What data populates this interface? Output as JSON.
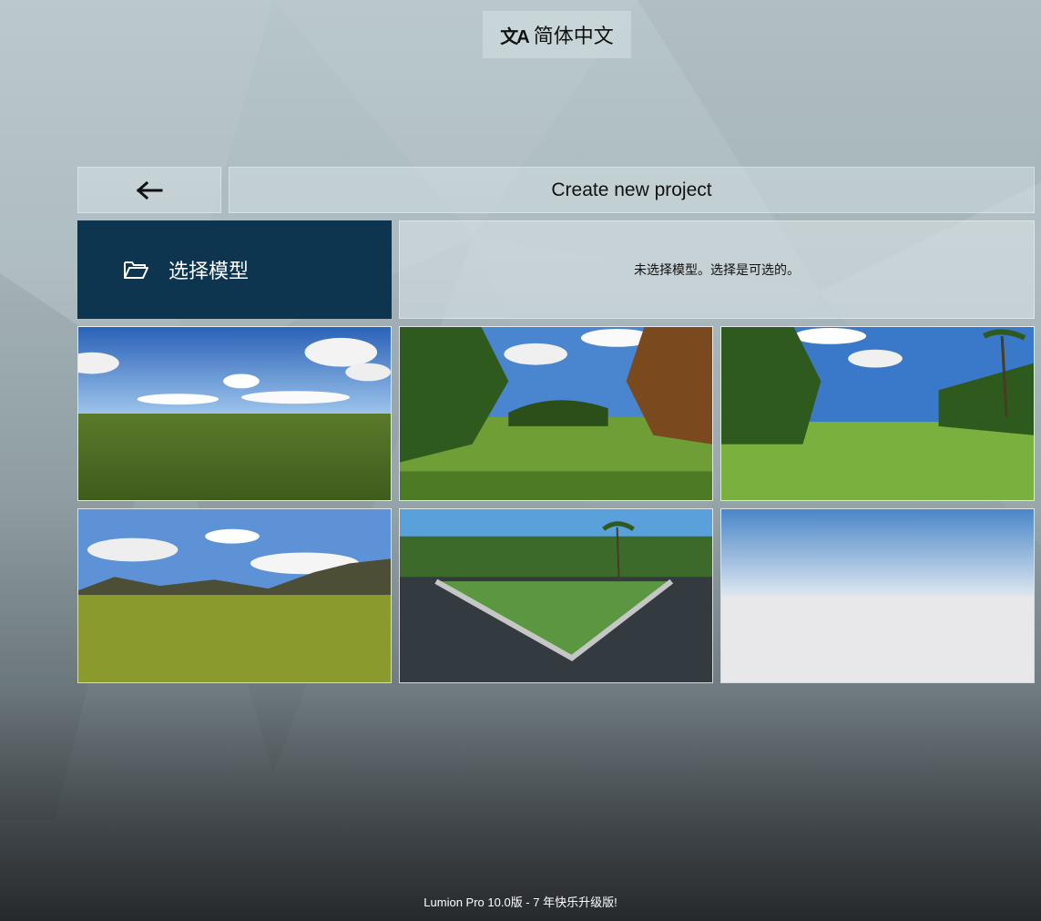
{
  "language": {
    "icon": "translate-icon",
    "icon_glyph": "文A",
    "label": "简体中文"
  },
  "header": {
    "back_icon": "arrow-left-icon",
    "title": "Create new project"
  },
  "model": {
    "button_icon": "folder-open-icon",
    "button_label": "选择模型",
    "status_text": "未选择模型。选择是可选的。"
  },
  "templates": [
    {
      "name": "grass-plain-sky"
    },
    {
      "name": "park-trees"
    },
    {
      "name": "tropical-park"
    },
    {
      "name": "mountain-grassland"
    },
    {
      "name": "road-intersection-park"
    },
    {
      "name": "blank-sky"
    }
  ],
  "footer": {
    "text": "Lumion Pro 10.0版 - 7 年快乐升级版!"
  },
  "colors": {
    "select_button_bg": "#0d3550"
  }
}
